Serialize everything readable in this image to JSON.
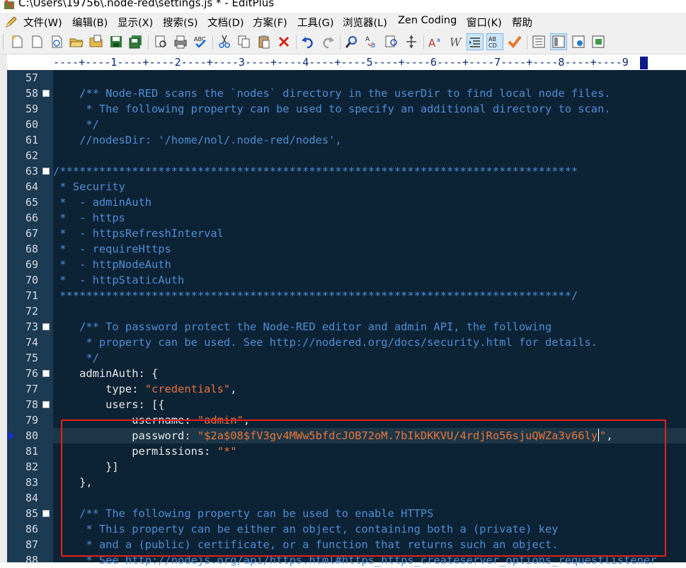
{
  "window": {
    "title": "C:\\Users\\19756\\.node-red\\settings.js * - EditPlus"
  },
  "menu": {
    "items": [
      "文件(W)",
      "编辑(B)",
      "显示(X)",
      "搜索(S)",
      "文档(D)",
      "方案(F)",
      "工具(G)",
      "浏览器(L)",
      "Zen Coding",
      "窗口(K)",
      "帮助"
    ]
  },
  "toolbar": {
    "buttons": [
      "new-file",
      "new-blank",
      "new-html",
      "open",
      "open-folder",
      "save",
      "save-all",
      "print-preview",
      "print",
      "spell-check",
      "cut",
      "copy",
      "paste",
      "delete",
      "undo",
      "redo",
      "find",
      "replace",
      "find-in-files",
      "goto",
      "font-size",
      "italic",
      "indent",
      "word-wrap",
      "check",
      "view-1",
      "view-2",
      "view-3",
      "view-4"
    ]
  },
  "ruler": {
    "text": "----+----1----+----2----+----3----+----4----+----5----+----6----+----7----+----8----+----9"
  },
  "editor": {
    "current_line": 80,
    "lines": [
      {
        "n": "57",
        "fold": false,
        "parts": []
      },
      {
        "n": "58",
        "fold": true,
        "parts": [
          {
            "t": "    /** Node-RED scans the `nodes` directory in the userDir to find local node files.",
            "c": "comment"
          }
        ]
      },
      {
        "n": "59",
        "fold": false,
        "parts": [
          {
            "t": "     * The following property can be used to specify an additional directory to scan.",
            "c": "comment"
          }
        ]
      },
      {
        "n": "60",
        "fold": false,
        "parts": [
          {
            "t": "     */",
            "c": "comment"
          }
        ]
      },
      {
        "n": "61",
        "fold": false,
        "parts": [
          {
            "t": "    //nodesDir: '/home/nol/.node-red/nodes',",
            "c": "comment"
          }
        ]
      },
      {
        "n": "62",
        "fold": false,
        "parts": []
      },
      {
        "n": "63",
        "fold": true,
        "parts": [
          {
            "t": "/*******************************************************************************",
            "c": "comment"
          }
        ]
      },
      {
        "n": "64",
        "fold": false,
        "parts": [
          {
            "t": " * Security",
            "c": "comment"
          }
        ]
      },
      {
        "n": "65",
        "fold": false,
        "parts": [
          {
            "t": " *  - adminAuth",
            "c": "comment"
          }
        ]
      },
      {
        "n": "66",
        "fold": false,
        "parts": [
          {
            "t": " *  - https",
            "c": "comment"
          }
        ]
      },
      {
        "n": "67",
        "fold": false,
        "parts": [
          {
            "t": " *  - httpsRefreshInterval",
            "c": "comment"
          }
        ]
      },
      {
        "n": "68",
        "fold": false,
        "parts": [
          {
            "t": " *  - requireHttps",
            "c": "comment"
          }
        ]
      },
      {
        "n": "69",
        "fold": false,
        "parts": [
          {
            "t": " *  - httpNodeAuth",
            "c": "comment"
          }
        ]
      },
      {
        "n": "70",
        "fold": false,
        "parts": [
          {
            "t": " *  - httpStaticAuth",
            "c": "comment"
          }
        ]
      },
      {
        "n": "71",
        "fold": false,
        "parts": [
          {
            "t": " ******************************************************************************/",
            "c": "comment"
          }
        ]
      },
      {
        "n": "72",
        "fold": false,
        "parts": []
      },
      {
        "n": "73",
        "fold": true,
        "parts": [
          {
            "t": "    /** To password protect the Node-RED editor and admin API, the following",
            "c": "comment"
          }
        ]
      },
      {
        "n": "74",
        "fold": false,
        "parts": [
          {
            "t": "     * property can be used. See http://nodered.org/docs/security.html for details.",
            "c": "comment"
          }
        ]
      },
      {
        "n": "75",
        "fold": false,
        "parts": [
          {
            "t": "     */",
            "c": "comment"
          }
        ]
      },
      {
        "n": "76",
        "fold": true,
        "parts": [
          {
            "t": "    adminAuth: {",
            "c": "key"
          }
        ]
      },
      {
        "n": "77",
        "fold": false,
        "parts": [
          {
            "t": "        type: ",
            "c": "key"
          },
          {
            "t": "\"credentials\"",
            "c": "str"
          },
          {
            "t": ",",
            "c": "punc"
          }
        ]
      },
      {
        "n": "78",
        "fold": true,
        "parts": [
          {
            "t": "        users: [{",
            "c": "key"
          }
        ]
      },
      {
        "n": "79",
        "fold": false,
        "parts": [
          {
            "t": "            username: ",
            "c": "key"
          },
          {
            "t": "\"admin\"",
            "c": "str"
          },
          {
            "t": ",",
            "c": "punc"
          }
        ]
      },
      {
        "n": "80",
        "fold": false,
        "parts": [
          {
            "t": "            password: ",
            "c": "key"
          },
          {
            "t": "\"$2a$08$fV3gv4MWw5bfdcJOB72oM.7bIkDKKVU/4rdjRo56sjuQWZa3v66ly",
            "c": "str"
          },
          {
            "t": "|",
            "c": "caret"
          },
          {
            "t": "\"",
            "c": "str"
          },
          {
            "t": ",",
            "c": "punc"
          }
        ]
      },
      {
        "n": "81",
        "fold": false,
        "parts": [
          {
            "t": "            permissions: ",
            "c": "key"
          },
          {
            "t": "\"*\"",
            "c": "str"
          }
        ]
      },
      {
        "n": "82",
        "fold": false,
        "parts": [
          {
            "t": "        }]",
            "c": "key"
          }
        ]
      },
      {
        "n": "83",
        "fold": false,
        "parts": [
          {
            "t": "    },",
            "c": "key"
          }
        ]
      },
      {
        "n": "84",
        "fold": false,
        "parts": []
      },
      {
        "n": "85",
        "fold": true,
        "parts": [
          {
            "t": "    /** The following property can be used to enable HTTPS",
            "c": "comment"
          }
        ]
      },
      {
        "n": "86",
        "fold": false,
        "parts": [
          {
            "t": "     * This property can be either an object, containing both a (private) key",
            "c": "comment"
          }
        ]
      },
      {
        "n": "87",
        "fold": false,
        "parts": [
          {
            "t": "     * and a (public) certificate, or a function that returns such an object.",
            "c": "comment"
          }
        ]
      },
      {
        "n": "88",
        "fold": false,
        "parts": [
          {
            "t": "     * See http://nodejs.org/api/https.html#https_https_createserver_options_requestlistener",
            "c": "comment"
          }
        ]
      }
    ]
  },
  "colors": {
    "code_background": "#0c2235",
    "gutter_background": "#1c3a52",
    "comment": "#4f8fd4",
    "string": "#e8763a",
    "text": "#e8e8e8",
    "highlight_box": "#e8201a"
  }
}
